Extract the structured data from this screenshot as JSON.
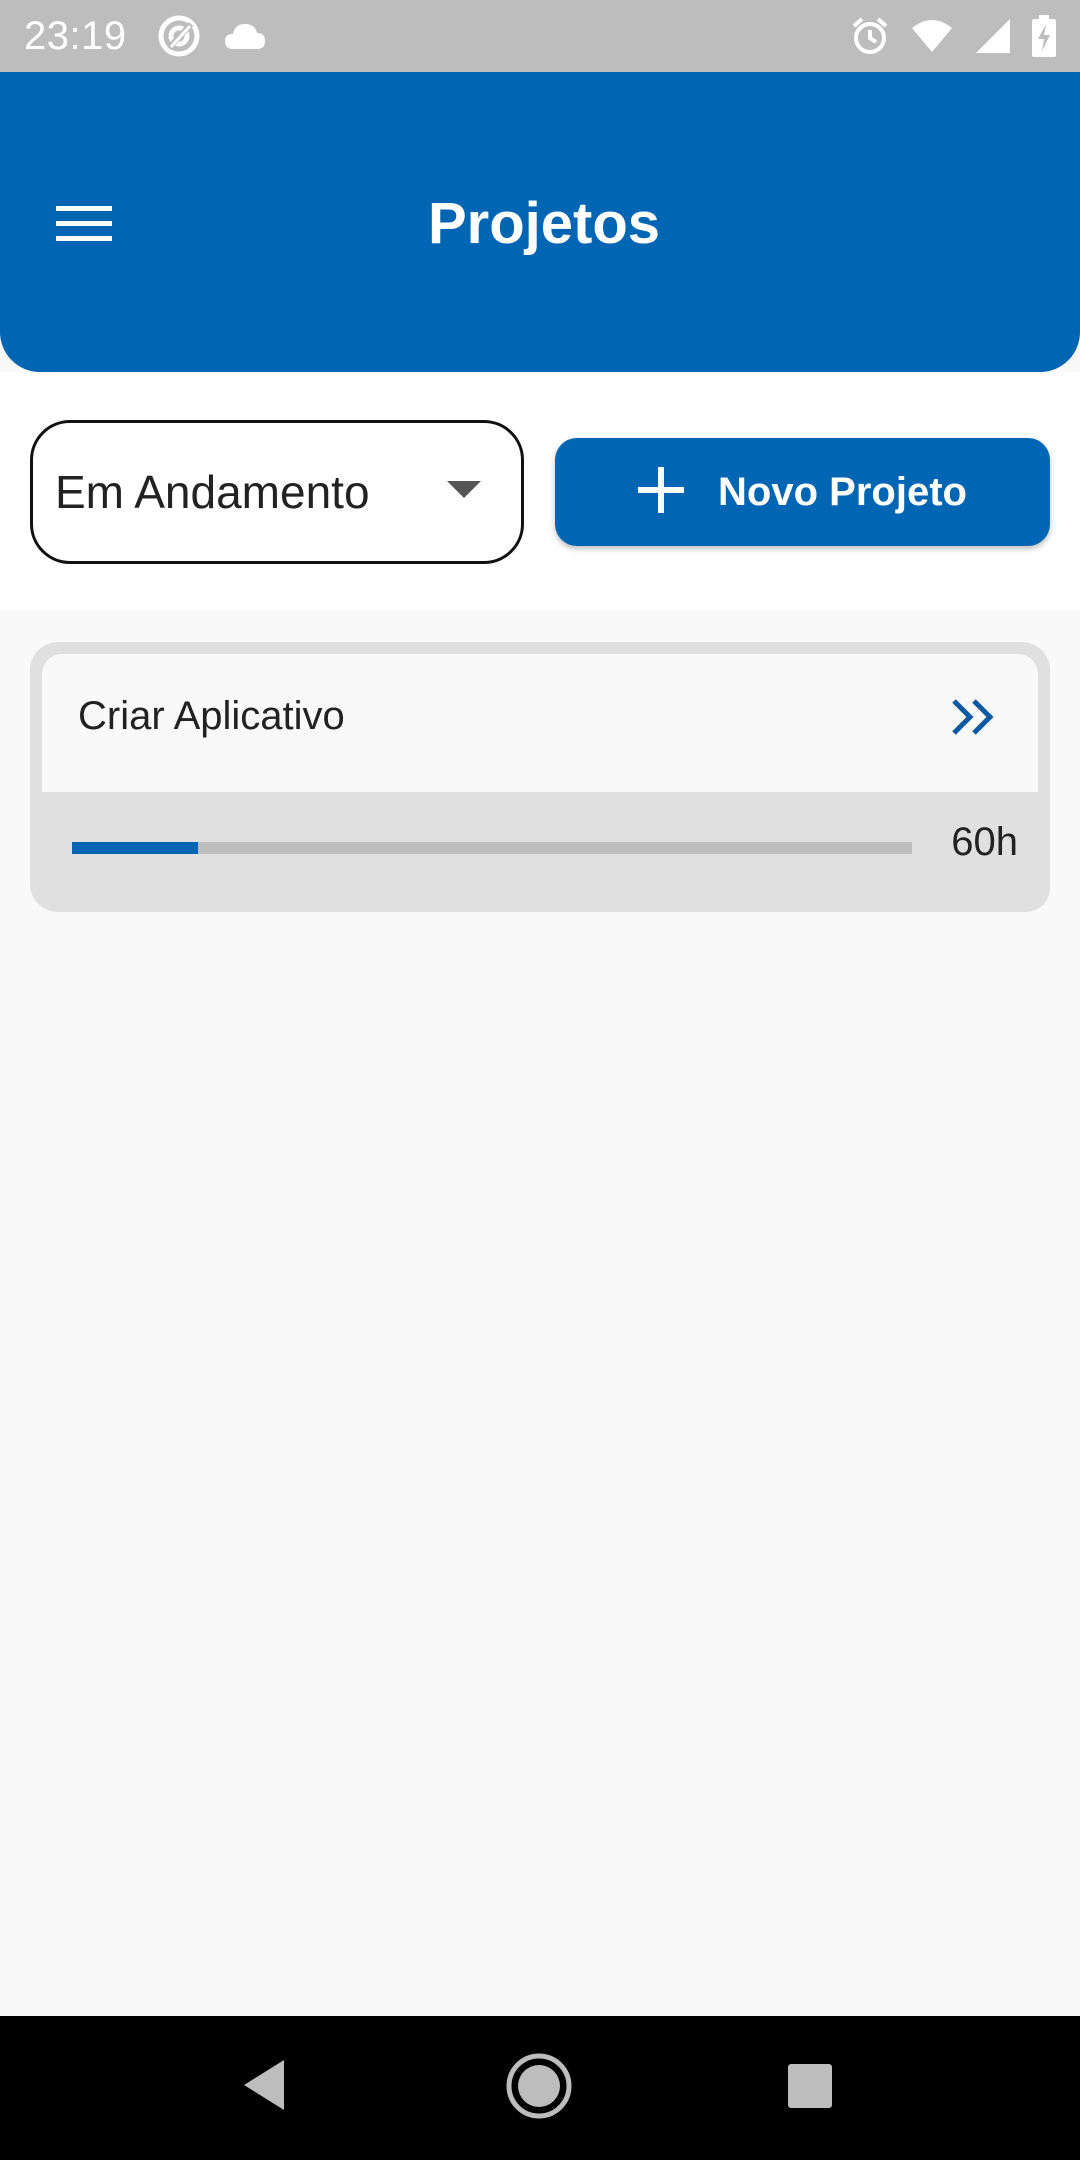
{
  "status_bar": {
    "time": "23:19",
    "icons": [
      "at-sign-icon",
      "cloud-icon",
      "alarm-icon",
      "wifi-icon",
      "signal-icon",
      "battery-charging-icon"
    ]
  },
  "app_bar": {
    "title": "Projetos",
    "menu_icon": "hamburger-menu-icon",
    "color": "#0066b3"
  },
  "filter": {
    "selected": "Em Andamento",
    "icon": "dropdown-arrow-icon"
  },
  "new_project_button": {
    "label": "Novo Projeto",
    "icon": "plus-icon"
  },
  "projects": [
    {
      "name": "Criar Aplicativo",
      "hours": "60h",
      "progress_fraction": 0.15,
      "open_icon": "double-chevron-right-icon"
    }
  ],
  "nav_bar": {
    "buttons": [
      "back-icon",
      "home-icon",
      "recents-icon"
    ]
  }
}
